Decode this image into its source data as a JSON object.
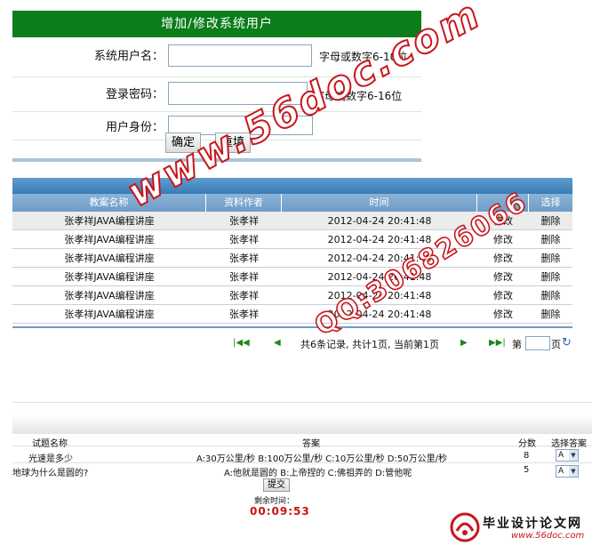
{
  "form": {
    "title": "增加/修改系统用户",
    "username_label": "系统用户名：",
    "username_hint": "字母或数字6-10位",
    "password_label": "登录密码：",
    "password_hint": "字母或数字6-16位",
    "role_label": "用户身份：",
    "confirm_label": "确定",
    "reset_label": "重填"
  },
  "table": {
    "columns": [
      "教案名称",
      "资料作者",
      "时间",
      "",
      "选择"
    ],
    "rows": [
      {
        "name": "张孝祥JAVA编程讲座",
        "author": "张孝祥",
        "time": "2012-04-24 20:41:48",
        "edit": "修改",
        "delete": "删除"
      },
      {
        "name": "张孝祥JAVA编程讲座",
        "author": "张孝祥",
        "time": "2012-04-24 20:41:48",
        "edit": "修改",
        "delete": "删除"
      },
      {
        "name": "张孝祥JAVA编程讲座",
        "author": "张孝祥",
        "time": "2012-04-24 20:41:48",
        "edit": "修改",
        "delete": "删除"
      },
      {
        "name": "张孝祥JAVA编程讲座",
        "author": "张孝祥",
        "time": "2012-04-24 20:41:48",
        "edit": "修改",
        "delete": "删除"
      },
      {
        "name": "张孝祥JAVA编程讲座",
        "author": "张孝祥",
        "time": "2012-04-24 20:41:48",
        "edit": "修改",
        "delete": "删除"
      },
      {
        "name": "张孝祥JAVA编程讲座",
        "author": "张孝祥",
        "time": "2012-04-24 20:41:48",
        "edit": "修改",
        "delete": "删除"
      }
    ]
  },
  "pager": {
    "summary": "共6条记录, 共计1页, 当前第1页",
    "page_prefix": "第",
    "page_suffix": "页",
    "first_icon": "first-page-icon",
    "prev_icon": "prev-page-icon",
    "next_icon": "next-page-icon",
    "last_icon": "last-page-icon"
  },
  "exam": {
    "headers": {
      "question": "试题名称",
      "answer": "答案",
      "score": "分数",
      "choice": "选择答案"
    },
    "questions": [
      {
        "question": "光速是多少",
        "answer": "A:30万公里/秒 B:100万公里/秒 C:10万公里/秒 D:50万公里/秒",
        "score": "8",
        "selected": "A"
      },
      {
        "question": "地球为什么是圆的?",
        "answer": "A:他就是圆的 B:上帝捏的 C:佛祖弄的 D:管他呢",
        "score": "5",
        "selected": "A"
      }
    ],
    "submit_label": "提交",
    "remaining_label": "剩余时间：",
    "remaining_time": "00:09:53"
  },
  "watermark": {
    "site": "www.56doc.com",
    "qq": "QQ:306826066",
    "logo_text": "毕业设计论文网",
    "logo_url": "www.56doc.com",
    "color": "#c8161d"
  },
  "colors": {
    "form_header": "#0b7d1a",
    "table_header": "#6f9cc6",
    "timer": "#cc1111"
  }
}
